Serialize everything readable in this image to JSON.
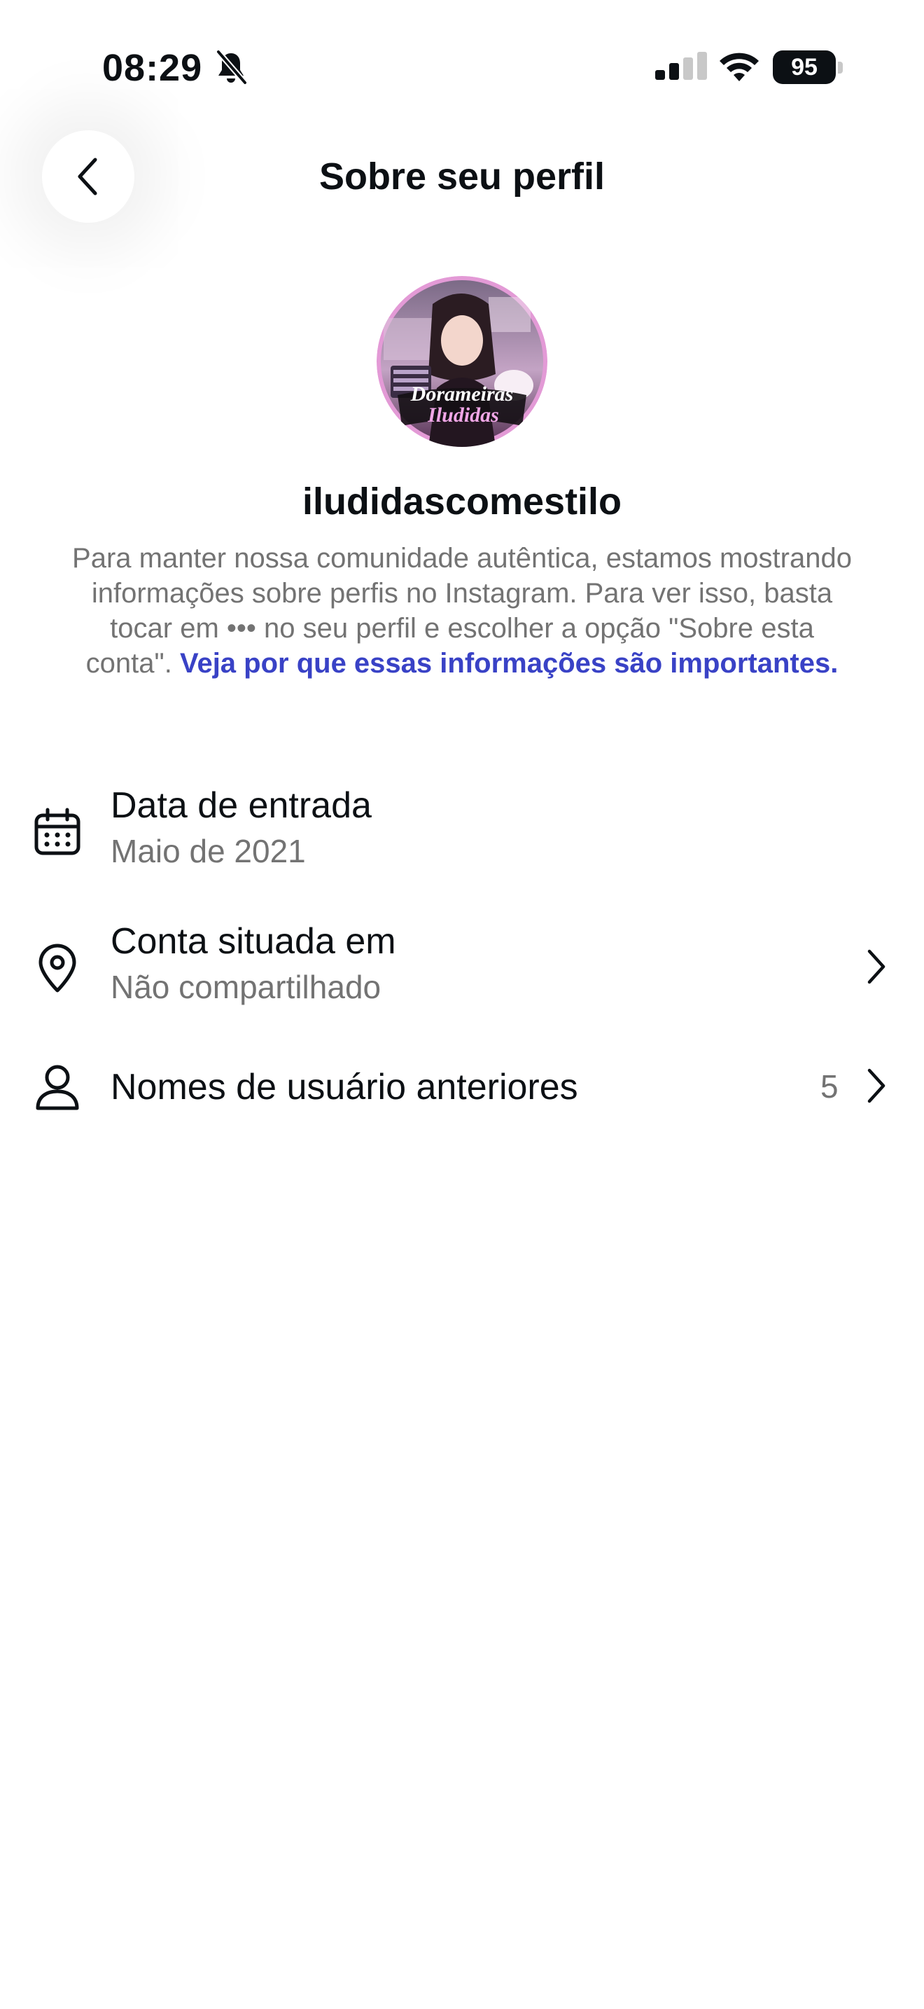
{
  "status_bar": {
    "time": "08:29",
    "battery": "95",
    "icons": [
      "bell-slash-icon",
      "cellular-signal-icon",
      "wifi-icon",
      "battery-icon"
    ]
  },
  "header": {
    "title": "Sobre seu perfil",
    "back_icon": "chevron-left-icon"
  },
  "profile": {
    "avatar_text_line1": "Dorameiras",
    "avatar_text_line2": "Iludidas",
    "username": "iludidascomestilo",
    "description": "Para manter nossa comunidade autêntica, estamos mostrando informações sobre perfis no Instagram. Para ver isso, basta tocar em ••• no seu perfil e escolher a opção \"Sobre esta conta\".",
    "link_text": "Veja por que essas informações são importantes."
  },
  "rows": [
    {
      "icon": "calendar-icon",
      "title": "Data de entrada",
      "subtitle": "Maio de 2021"
    },
    {
      "icon": "location-pin-icon",
      "title": "Conta situada em",
      "subtitle": "Não compartilhado",
      "trailing_icon": "chevron-right-icon"
    },
    {
      "icon": "person-icon",
      "title": "Nomes de usuário anteriores",
      "count": "5",
      "trailing_icon": "chevron-right-icon"
    }
  ],
  "colors": {
    "text": "#0c1014",
    "secondary_text": "#737373",
    "link": "#3942c6",
    "avatar_ring": "#e39ad6"
  }
}
